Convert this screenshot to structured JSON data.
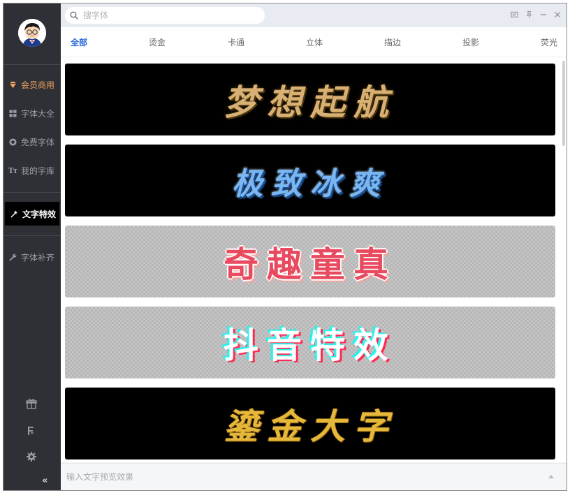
{
  "search": {
    "placeholder": "搜字体"
  },
  "sidebar": {
    "items": [
      {
        "label": "会员商用",
        "icon": "diamond-icon"
      },
      {
        "label": "字体大全",
        "icon": "grid-icon"
      },
      {
        "label": "免费字体",
        "icon": "coin-icon"
      },
      {
        "label": "我的字库",
        "icon": "font-tt-icon"
      },
      {
        "label": "文字特效",
        "icon": "magic-wand-icon",
        "active": true
      },
      {
        "label": "字体补齐",
        "icon": "wrench-icon"
      }
    ],
    "bottom_icons": [
      "gift-icon",
      "font-f-icon",
      "settings-icon"
    ],
    "collapse_label": "«"
  },
  "tabs": [
    {
      "label": "全部",
      "active": true
    },
    {
      "label": "烫金"
    },
    {
      "label": "卡通"
    },
    {
      "label": "立体"
    },
    {
      "label": "描边"
    },
    {
      "label": "投影"
    },
    {
      "label": "荧光"
    }
  ],
  "effects": [
    {
      "text": "梦想起航",
      "background": "dark",
      "style": "gold-brush"
    },
    {
      "text": "极致冰爽",
      "background": "dark",
      "style": "ice"
    },
    {
      "text": "奇趣童真",
      "background": "transparent",
      "style": "pink-outline"
    },
    {
      "text": "抖音特效",
      "background": "transparent",
      "style": "tiktok-glitch"
    },
    {
      "text": "鎏金大字",
      "background": "dark",
      "style": "gold-foil"
    }
  ],
  "preview": {
    "placeholder": "输入文字预览效果"
  },
  "colors": {
    "sidebar_bg": "#2e3035",
    "vip_accent": "#f0a060",
    "tab_active": "#2a6ad8",
    "topbar_bg": "#e8ecf2"
  }
}
